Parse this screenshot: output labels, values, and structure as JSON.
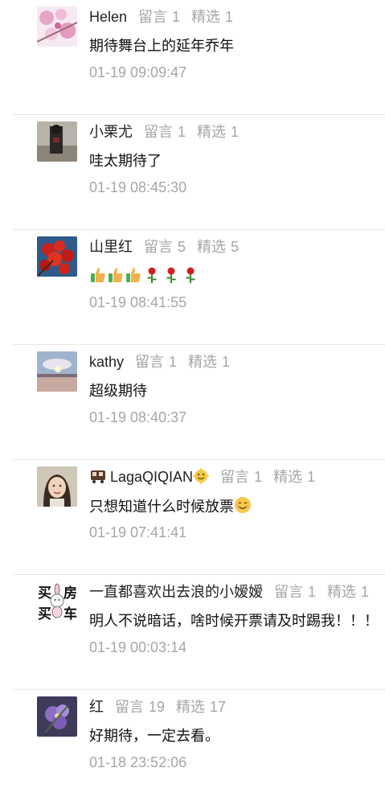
{
  "labels": {
    "comments": "留言",
    "featured": "精选"
  },
  "comments": [
    {
      "name": "Helen",
      "comment_count": "1",
      "featured_count": "1",
      "text": "期待舞台上的延年乔年",
      "time": "01-19 09:09:47"
    },
    {
      "name": "小栗尤",
      "comment_count": "1",
      "featured_count": "1",
      "text": "哇太期待了",
      "time": "01-19 08:45:30"
    },
    {
      "name": "山里红",
      "comment_count": "5",
      "featured_count": "5",
      "text": "",
      "emojis": [
        "thumbs-up-icon",
        "thumbs-up-icon",
        "thumbs-up-icon",
        "rose-icon",
        "rose-icon",
        "rose-icon"
      ],
      "time": "01-19 08:41:55"
    },
    {
      "name": "kathy",
      "comment_count": "1",
      "featured_count": "1",
      "text": "超级期待",
      "time": "01-19 08:40:37"
    },
    {
      "name": "LagaQIQIAN",
      "comment_count": "1",
      "featured_count": "1",
      "text": "只想知道什么时候放票",
      "name_prefix_icon": "train-icon",
      "name_suffix_icon": "smile-face-icon",
      "text_suffix_icon": "smile-face-icon",
      "time": "01-19 07:41:41"
    },
    {
      "name": "一直都喜欢出去浪的小嫒嫒",
      "comment_count": "1",
      "featured_count": "1",
      "text": "明人不说暗话，啥时候开票请及时踢我！！！",
      "time": "01-19 00:03:14",
      "avatar_text": [
        "买",
        "房",
        "买",
        "车"
      ]
    },
    {
      "name": "红",
      "comment_count": "19",
      "featured_count": "17",
      "text": "好期待，一定去看。",
      "time": "01-18 23:52:06"
    }
  ],
  "colors": {
    "name": "#222222",
    "meta": "#a6a6a6",
    "text": "#111111",
    "divider": "#e6e6e6"
  }
}
